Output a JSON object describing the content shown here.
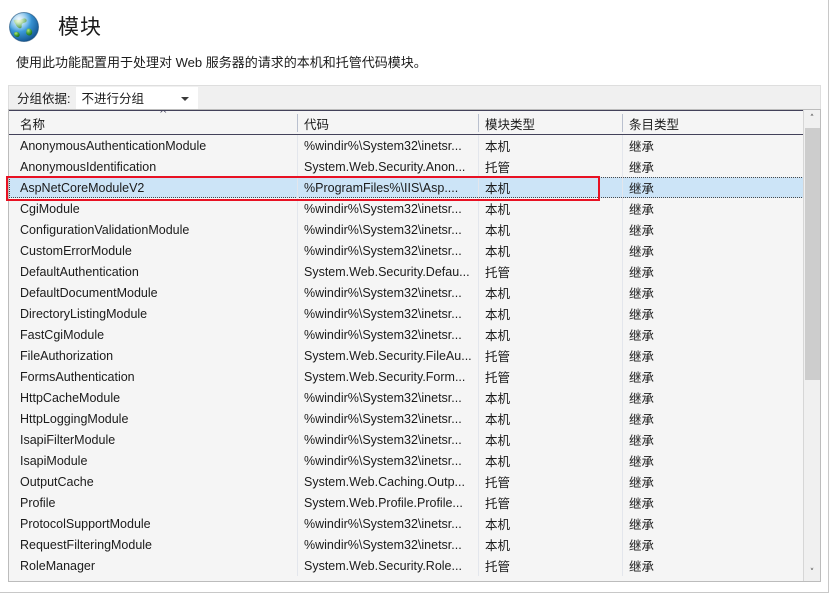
{
  "header": {
    "icon": "globe-icon",
    "title": "模块",
    "description": "使用此功能配置用于处理对 Web 服务器的请求的本机和托管代码模块。"
  },
  "toolbar": {
    "group_by_label": "分组依据:",
    "group_by_value": "不进行分组",
    "group_by_options": [
      "不进行分组"
    ],
    "dropdown_icon": "chevron-down-icon"
  },
  "grid": {
    "columns": [
      {
        "key": "name",
        "label": "名称"
      },
      {
        "key": "code",
        "label": "代码"
      },
      {
        "key": "module_type",
        "label": "模块类型"
      },
      {
        "key": "entry_type",
        "label": "条目类型"
      }
    ],
    "sort": {
      "column": "名称",
      "direction": "asc",
      "indicator": "^"
    },
    "selected_row_index": 2,
    "rows": [
      {
        "name": "AnonymousAuthenticationModule",
        "code": "%windir%\\System32\\inetsr...",
        "module_type": "本机",
        "entry_type": "继承"
      },
      {
        "name": "AnonymousIdentification",
        "code": "System.Web.Security.Anon...",
        "module_type": "托管",
        "entry_type": "继承"
      },
      {
        "name": "AspNetCoreModuleV2",
        "code": "%ProgramFiles%\\IIS\\Asp....",
        "module_type": "本机",
        "entry_type": "继承"
      },
      {
        "name": "CgiModule",
        "code": "%windir%\\System32\\inetsr...",
        "module_type": "本机",
        "entry_type": "继承"
      },
      {
        "name": "ConfigurationValidationModule",
        "code": "%windir%\\System32\\inetsr...",
        "module_type": "本机",
        "entry_type": "继承"
      },
      {
        "name": "CustomErrorModule",
        "code": "%windir%\\System32\\inetsr...",
        "module_type": "本机",
        "entry_type": "继承"
      },
      {
        "name": "DefaultAuthentication",
        "code": "System.Web.Security.Defau...",
        "module_type": "托管",
        "entry_type": "继承"
      },
      {
        "name": "DefaultDocumentModule",
        "code": "%windir%\\System32\\inetsr...",
        "module_type": "本机",
        "entry_type": "继承"
      },
      {
        "name": "DirectoryListingModule",
        "code": "%windir%\\System32\\inetsr...",
        "module_type": "本机",
        "entry_type": "继承"
      },
      {
        "name": "FastCgiModule",
        "code": "%windir%\\System32\\inetsr...",
        "module_type": "本机",
        "entry_type": "继承"
      },
      {
        "name": "FileAuthorization",
        "code": "System.Web.Security.FileAu...",
        "module_type": "托管",
        "entry_type": "继承"
      },
      {
        "name": "FormsAuthentication",
        "code": "System.Web.Security.Form...",
        "module_type": "托管",
        "entry_type": "继承"
      },
      {
        "name": "HttpCacheModule",
        "code": "%windir%\\System32\\inetsr...",
        "module_type": "本机",
        "entry_type": "继承"
      },
      {
        "name": "HttpLoggingModule",
        "code": "%windir%\\System32\\inetsr...",
        "module_type": "本机",
        "entry_type": "继承"
      },
      {
        "name": "IsapiFilterModule",
        "code": "%windir%\\System32\\inetsr...",
        "module_type": "本机",
        "entry_type": "继承"
      },
      {
        "name": "IsapiModule",
        "code": "%windir%\\System32\\inetsr...",
        "module_type": "本机",
        "entry_type": "继承"
      },
      {
        "name": "OutputCache",
        "code": "System.Web.Caching.Outp...",
        "module_type": "托管",
        "entry_type": "继承"
      },
      {
        "name": "Profile",
        "code": "System.Web.Profile.Profile...",
        "module_type": "托管",
        "entry_type": "继承"
      },
      {
        "name": "ProtocolSupportModule",
        "code": "%windir%\\System32\\inetsr...",
        "module_type": "本机",
        "entry_type": "继承"
      },
      {
        "name": "RequestFilteringModule",
        "code": "%windir%\\System32\\inetsr...",
        "module_type": "本机",
        "entry_type": "继承"
      },
      {
        "name": "RoleManager",
        "code": "System.Web.Security.Role...",
        "module_type": "托管",
        "entry_type": "继承"
      }
    ]
  },
  "scrollbar": {
    "up_icon": "chevron-up-icon",
    "down_icon": "chevron-down-icon",
    "up_glyph": "˄",
    "down_glyph": "˅"
  },
  "annotation": {
    "shape": "rectangle",
    "color": "#e81123",
    "target_row": "AspNetCoreModuleV2"
  },
  "colors": {
    "selection": "#cce4f7",
    "header_rule": "#43425a",
    "grid_bg": "#f5f5f5",
    "annotation": "#e81123"
  }
}
